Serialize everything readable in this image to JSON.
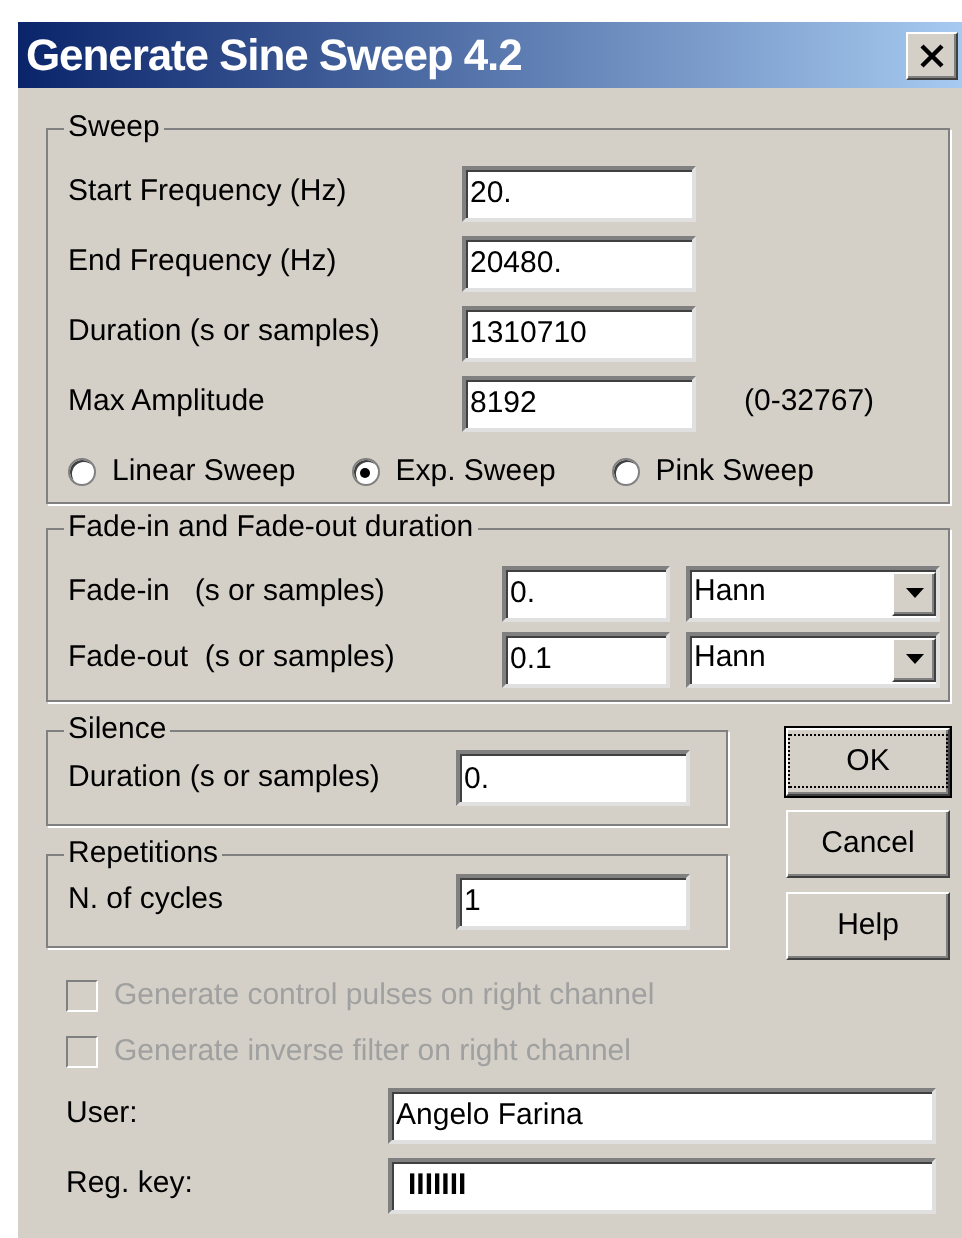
{
  "window": {
    "title": "Generate Sine Sweep 4.2"
  },
  "sweep": {
    "title": "Sweep",
    "fields": [
      {
        "label": "Start Frequency (Hz)",
        "value": "20."
      },
      {
        "label": "End Frequency (Hz)",
        "value": "20480."
      },
      {
        "label": "Duration (s or samples)",
        "value": "1310710"
      },
      {
        "label": "Max Amplitude",
        "value": "8192",
        "hint": "(0-32767)"
      }
    ],
    "modes": [
      {
        "label": "Linear Sweep",
        "selected": false
      },
      {
        "label": "Exp. Sweep",
        "selected": true
      },
      {
        "label": "Pink Sweep",
        "selected": false
      }
    ]
  },
  "fade": {
    "title": "Fade-in and Fade-out duration",
    "rows": [
      {
        "label": "Fade-in   (s or samples)",
        "value": "0.",
        "window": "Hann"
      },
      {
        "label": "Fade-out  (s or samples)",
        "value": "0.1",
        "window": "Hann"
      }
    ]
  },
  "silence": {
    "title": "Silence",
    "label": "Duration (s or samples)",
    "value": "0."
  },
  "repetitions": {
    "title": "Repetitions",
    "label": "N. of cycles",
    "value": "1"
  },
  "buttons": [
    {
      "label": "OK",
      "default": true
    },
    {
      "label": "Cancel",
      "default": false
    },
    {
      "label": "Help",
      "default": false
    }
  ],
  "options": [
    {
      "label": "Generate control pulses on right channel",
      "checked": false,
      "disabled": true
    },
    {
      "label": "Generate inverse filter on right channel",
      "checked": false,
      "disabled": true
    }
  ],
  "registration": [
    {
      "label": "User:",
      "value": "Angelo Farina"
    },
    {
      "label": "Reg. key:",
      "value": "IIIIIII",
      "masked": true
    }
  ]
}
